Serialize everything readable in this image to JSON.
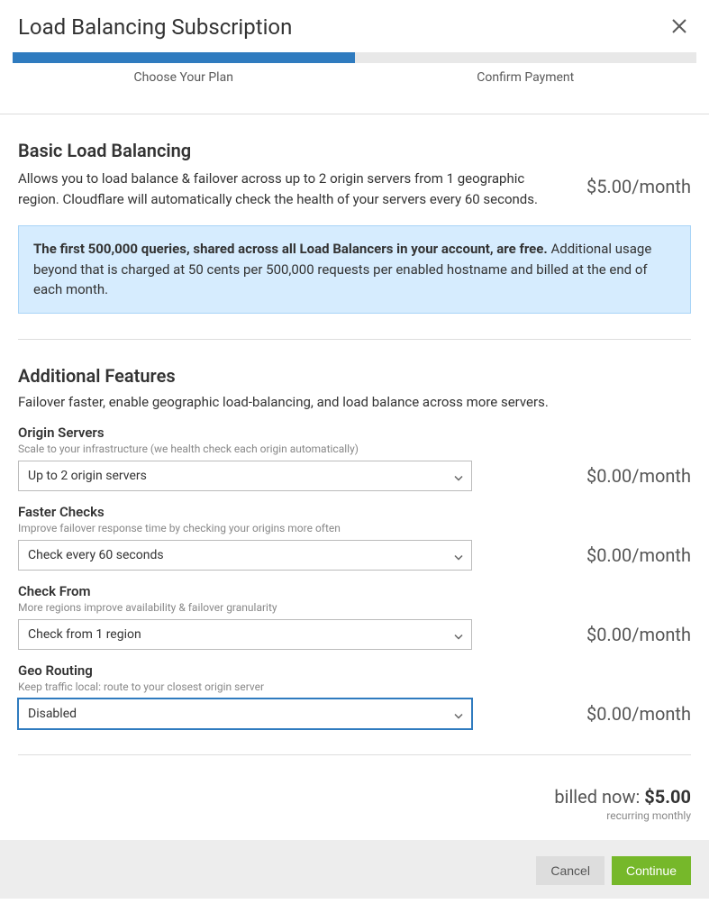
{
  "title": "Load Balancing Subscription",
  "steps": [
    "Choose Your Plan",
    "Confirm Payment"
  ],
  "basic": {
    "heading": "Basic Load Balancing",
    "desc": "Allows you to load balance & failover across up to 2 origin servers from 1 geographic region. Cloudflare will automatically check the health of your servers every 60 seconds.",
    "price": "$5.00/month",
    "info_bold": "The first 500,000 queries, shared across all Load Balancers in your account, are free.",
    "info_rest": " Additional usage beyond that is charged at 50 cents per 500,000 requests per enabled hostname and billed at the end of each month."
  },
  "additional": {
    "heading": "Additional Features",
    "desc": "Failover faster, enable geographic load-balancing, and load balance across more servers."
  },
  "features": [
    {
      "label": "Origin Servers",
      "hint": "Scale to your infrastructure (we health check each origin automatically)",
      "value": "Up to 2 origin servers",
      "price": "$0.00/month",
      "focused": false
    },
    {
      "label": "Faster Checks",
      "hint": "Improve failover response time by checking your origins more often",
      "value": "Check every 60 seconds",
      "price": "$0.00/month",
      "focused": false
    },
    {
      "label": "Check From",
      "hint": "More regions improve availability & failover granularity",
      "value": "Check from 1 region",
      "price": "$0.00/month",
      "focused": false
    },
    {
      "label": "Geo Routing",
      "hint": "Keep traffic local: route to your closest origin server",
      "value": "Disabled",
      "price": "$0.00/month",
      "focused": true
    }
  ],
  "billing": {
    "label": "billed now: ",
    "amount": "$5.00",
    "sub": "recurring monthly"
  },
  "buttons": {
    "cancel": "Cancel",
    "continue": "Continue"
  }
}
